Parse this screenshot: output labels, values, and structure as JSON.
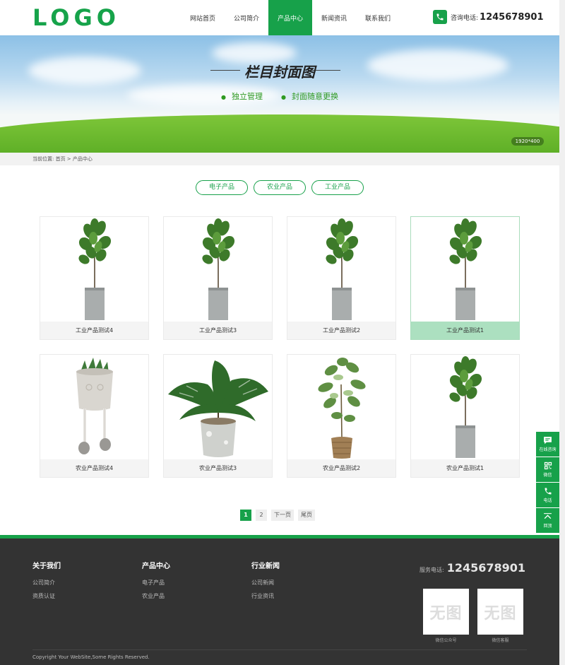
{
  "header": {
    "logo": "LOGO",
    "nav": [
      "网站首页",
      "公司简介",
      "产品中心",
      "新闻资讯",
      "联系我们"
    ],
    "active_nav": 2,
    "phone_label": "咨询电话:",
    "phone_number": "1245678901"
  },
  "banner": {
    "title": "栏目封面图",
    "subtitles": [
      "独立管理",
      "封面随意更换"
    ],
    "size_badge": "1920*400"
  },
  "breadcrumb": "当前位置: 首页 > 产品中心",
  "categories": [
    "电子产品",
    "农业产品",
    "工业产品"
  ],
  "products": [
    {
      "name": "工业产品测试4",
      "image": "fiddle-leaf-fig-icon"
    },
    {
      "name": "工业产品测试3",
      "image": "fiddle-leaf-fig-icon"
    },
    {
      "name": "工业产品测试2",
      "image": "fiddle-leaf-fig-icon"
    },
    {
      "name": "工业产品测试1",
      "image": "fiddle-leaf-fig-icon"
    },
    {
      "name": "农业产品测试4",
      "image": "succulent-pot-icon"
    },
    {
      "name": "农业产品测试3",
      "image": "monstera-icon"
    },
    {
      "name": "农业产品测试2",
      "image": "aralia-plant-icon"
    },
    {
      "name": "农业产品测试1",
      "image": "fiddle-leaf-fig-icon"
    }
  ],
  "pagination": [
    "1",
    "2",
    "下一页",
    "尾页"
  ],
  "float_bar": [
    "在线咨询",
    "微信",
    "电话",
    "回顶"
  ],
  "footer": {
    "about": {
      "title": "关于我们",
      "links": [
        "公司简介",
        "资质认证"
      ]
    },
    "products": {
      "title": "产品中心",
      "links": [
        "电子产品",
        "农业产品"
      ]
    },
    "news": {
      "title": "行业新闻",
      "links": [
        "公司新闻",
        "行业资讯"
      ]
    },
    "service_label": "服务电话:",
    "service_number": "1245678901",
    "qr_placeholder": "无图",
    "qr_captions": [
      "微信公众号",
      "微信客服"
    ],
    "copyright": "Copyright Your WebSite,Some Rights Reserved."
  },
  "colors": {
    "brand": "#17a14a",
    "footer_bg": "#333333"
  }
}
